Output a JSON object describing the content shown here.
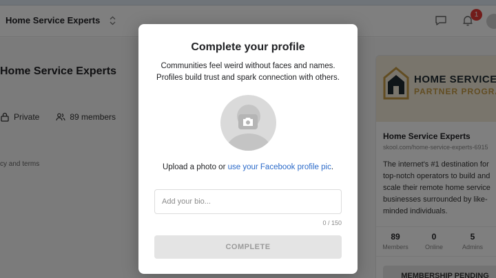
{
  "topbar": {
    "group_name": "Home Service Experts",
    "notification_count": "1"
  },
  "group": {
    "title": "Home Service Experts",
    "privacy": "Private",
    "members": "89 members",
    "policy_text": "cy and terms"
  },
  "side_card": {
    "banner_line1": "HOME SERVICE",
    "banner_line2": "PARTNER PROGRAM",
    "name": "Home Service Experts",
    "url": "skool.com/home-service-experts-6915",
    "description": "The internet's #1 destination for top-notch operators to build and scale their remote home service businesses surrounded by like-minded individuals.",
    "stats": [
      {
        "value": "89",
        "label": "Members"
      },
      {
        "value": "0",
        "label": "Online"
      },
      {
        "value": "5",
        "label": "Admins"
      }
    ],
    "pending_label": "MEMBERSHIP PENDING"
  },
  "modal": {
    "title": "Complete your profile",
    "subtitle_line1": "Communities feel weird without faces and names.",
    "subtitle_line2": "Profiles build trust and spark connection with others.",
    "upload_prefix": "Upload a photo or ",
    "upload_link": "use your Facebook profile pic",
    "upload_suffix": ".",
    "bio_placeholder": "Add your bio...",
    "bio_value": "",
    "bio_counter": "0 / 150",
    "complete_label": "COMPLETE"
  },
  "colors": {
    "accent_link": "#2b6ac9",
    "badge": "#e53935",
    "banner_gold": "#c59a45"
  }
}
